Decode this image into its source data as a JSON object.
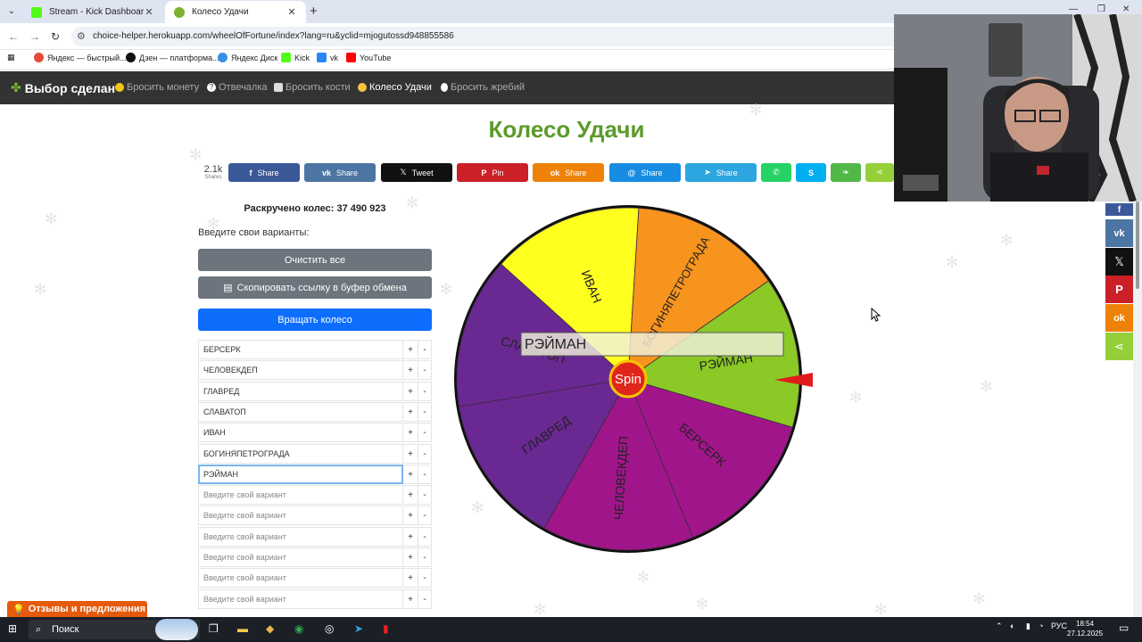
{
  "browser": {
    "tabs": [
      {
        "title": "Stream - Kick Dashboard",
        "favicon_color": "#53fc18"
      },
      {
        "title": "Колесо Удачи",
        "favicon_color": "#7bb32e"
      }
    ],
    "new_tab": "+",
    "url": "choice-helper.herokuapp.com/wheelOfFortune/index?lang=ru&yclid=mjogutossd948855586",
    "bookmarks": [
      {
        "label": "Яндекс — быстрый...",
        "color": "#e54a3a"
      },
      {
        "label": "Дзен — платформа...",
        "color": "#111111"
      },
      {
        "label": "Яндекс Диск",
        "color": "#3a8ee6"
      },
      {
        "label": "Kick",
        "color": "#53fc18"
      },
      {
        "label": "vk",
        "color": "#2787f5"
      },
      {
        "label": "YouTube",
        "color": "#ff0000"
      }
    ]
  },
  "site_nav": {
    "brand": "Выбор сделан",
    "links": [
      {
        "label": "Бросить монету",
        "icon": "coin-icon",
        "active": false
      },
      {
        "label": "Отвечалка",
        "icon": "question-icon",
        "active": false
      },
      {
        "label": "Бросить кости",
        "icon": "dice-icon",
        "active": false
      },
      {
        "label": "Колесо Удачи",
        "icon": "wheel-icon",
        "active": true
      },
      {
        "label": "Бросить жребий",
        "icon": "lot-icon",
        "active": false
      }
    ]
  },
  "page_title": "Колесо Удачи",
  "share": {
    "count": "2.1k",
    "count_label": "Shares",
    "buttons": [
      {
        "label": "Share",
        "icon": "f",
        "color": "#3b5998"
      },
      {
        "label": "Share",
        "icon": "vk",
        "color": "#4c75a3"
      },
      {
        "label": "Tweet",
        "icon": "X",
        "color": "#111111"
      },
      {
        "label": "Pin",
        "icon": "P",
        "color": "#cb2027"
      },
      {
        "label": "Share",
        "icon": "ok",
        "color": "#ee8208"
      },
      {
        "label": "Share",
        "icon": "@",
        "color": "#168de2"
      },
      {
        "label": "Share",
        "icon": "tg",
        "color": "#2ca5e0"
      },
      {
        "label": "",
        "icon": "wa",
        "color": "#25d366"
      },
      {
        "label": "",
        "icon": "S",
        "color": "#00aff0"
      },
      {
        "label": "",
        "icon": "ev",
        "color": "#51b848"
      },
      {
        "label": "",
        "icon": "<",
        "color": "#95d03a"
      }
    ]
  },
  "counter_text": "Раскручено колес: 37 490 923",
  "enter_label": "Введите свои варианты:",
  "buttons": {
    "clear": "Очистить все",
    "copy": "Скопировать ссылку в буфер обмена",
    "spin_wheel": "Вращать колесо"
  },
  "placeholder": "Введите свой вариант",
  "options": [
    "БЕРСЕРК",
    "ЧЕЛОВЕКДЕП",
    "ГЛАВРЕД",
    "СЛАВАТОП",
    "ИВАН",
    "БОГИНЯПЕТРОГРАДА",
    "РЭЙМАН",
    "",
    "",
    "",
    "",
    "",
    ""
  ],
  "focused_index": 6,
  "row_plus": "+",
  "row_minus": "-",
  "wheel": {
    "spin_label": "Spin",
    "result_label": "РЭЙМАН",
    "segments": [
      {
        "label": "РЭЙМАН",
        "color": "#8ac926"
      },
      {
        "label": "БЕРСЕРК",
        "color": "#a0168a"
      },
      {
        "label": "ЧЕЛОВЕКДЕП",
        "color": "#a0168a"
      },
      {
        "label": "ГЛАВРЕД",
        "color": "#6a2893"
      },
      {
        "label": "СЛАВАТОП",
        "color": "#6a2893"
      },
      {
        "label": "ИВАН",
        "color": "#ffff1f"
      },
      {
        "label": "БОГИНЯПЕТРОГРАДА",
        "color": "#f7941d"
      }
    ]
  },
  "side_share": [
    {
      "icon": "f",
      "color": "#3b5998"
    },
    {
      "icon": "vk",
      "color": "#4c75a3"
    },
    {
      "icon": "X",
      "color": "#111111"
    },
    {
      "icon": "P",
      "color": "#cb2027"
    },
    {
      "icon": "ok",
      "color": "#ee8208"
    },
    {
      "icon": "<",
      "color": "#95d03a"
    }
  ],
  "feedback": "Отзывы и предложения",
  "taskbar": {
    "search": "Поиск",
    "language": "РУС",
    "time": "18:54",
    "date": "27.12.2025"
  }
}
